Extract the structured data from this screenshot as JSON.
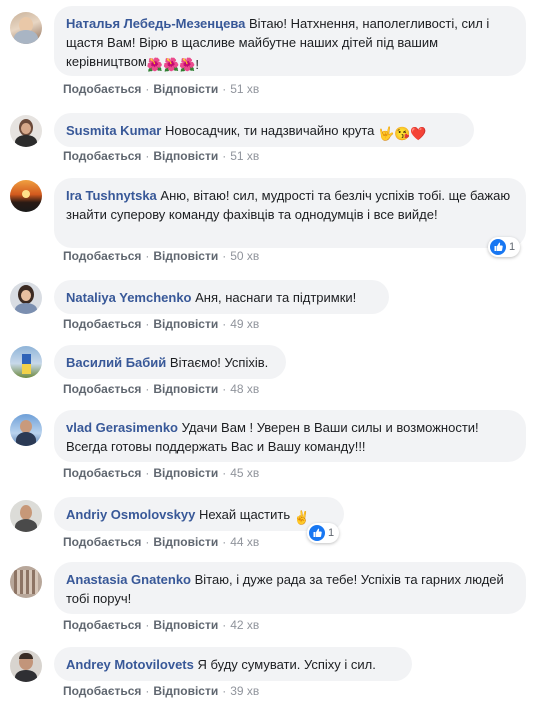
{
  "comments": [
    {
      "author": "Наталья Лебедь-Мезенцева",
      "text": "Вітаю! Натхнення, наполегливості, сил і щастя Вам! Вірю в щасливе майбутне наших дітей під вашим керівництвом",
      "emoji_suffix": "🌺🌺🌺!",
      "like": "Подобається",
      "reply": "Відповісти",
      "time": "51 хв"
    },
    {
      "author": "Susmita Kumar",
      "text": "Новосадчик, ти надзвичайно крута",
      "emoji_suffix": "🤟😘❤️",
      "like": "Подобається",
      "reply": "Відповісти",
      "time": "51 хв"
    },
    {
      "author": "Ira Tushnytska",
      "text": "Аню, вітаю! сил, мудрості та безліч успіхів тобі. ще бажаю знайти суперову команду фахівців та однодумців і все вийде!",
      "like": "Подобається",
      "reply": "Відповісти",
      "time": "50 хв",
      "reactions": "1"
    },
    {
      "author": "Nataliya Yemchenko",
      "text": "Аня, наснаги та підтримки!",
      "like": "Подобається",
      "reply": "Відповісти",
      "time": "49 хв"
    },
    {
      "author": "Василий Бабий",
      "text": "Вітаємо! Успіхів.",
      "like": "Подобається",
      "reply": "Відповісти",
      "time": "48 хв"
    },
    {
      "author": "vlad Gerasimenko",
      "text": "Удачи Вам ! Уверен в Ваши силы и возможности! Всегда готовы поддержать Вас и Вашу команду!!!",
      "like": "Подобається",
      "reply": "Відповісти",
      "time": "45 хв"
    },
    {
      "author": "Andriy Osmolovskyy",
      "text": "Нехай щастить",
      "emoji_suffix": "✌️",
      "like": "Подобається",
      "reply": "Відповісти",
      "time": "44 хв",
      "reactions": "1"
    },
    {
      "author": "Anastasia Gnatenko",
      "text": "Вітаю, і дуже рада за тебе! Успіхів та гарних людей тобі поруч!",
      "like": "Подобається",
      "reply": "Відповісти",
      "time": "42 хв"
    },
    {
      "author": "Andrey Motovilovets",
      "text": "Я буду сумувати. Успіху і сил.",
      "like": "Подобається",
      "reply": "Відповісти",
      "time": "39 хв"
    }
  ],
  "icons": {
    "like_reaction": "thumbs-up-icon",
    "reaction_color": "#1877f2"
  },
  "colors": {
    "author": "#385898",
    "bubble": "#f2f3f5",
    "meta": "#606770"
  }
}
